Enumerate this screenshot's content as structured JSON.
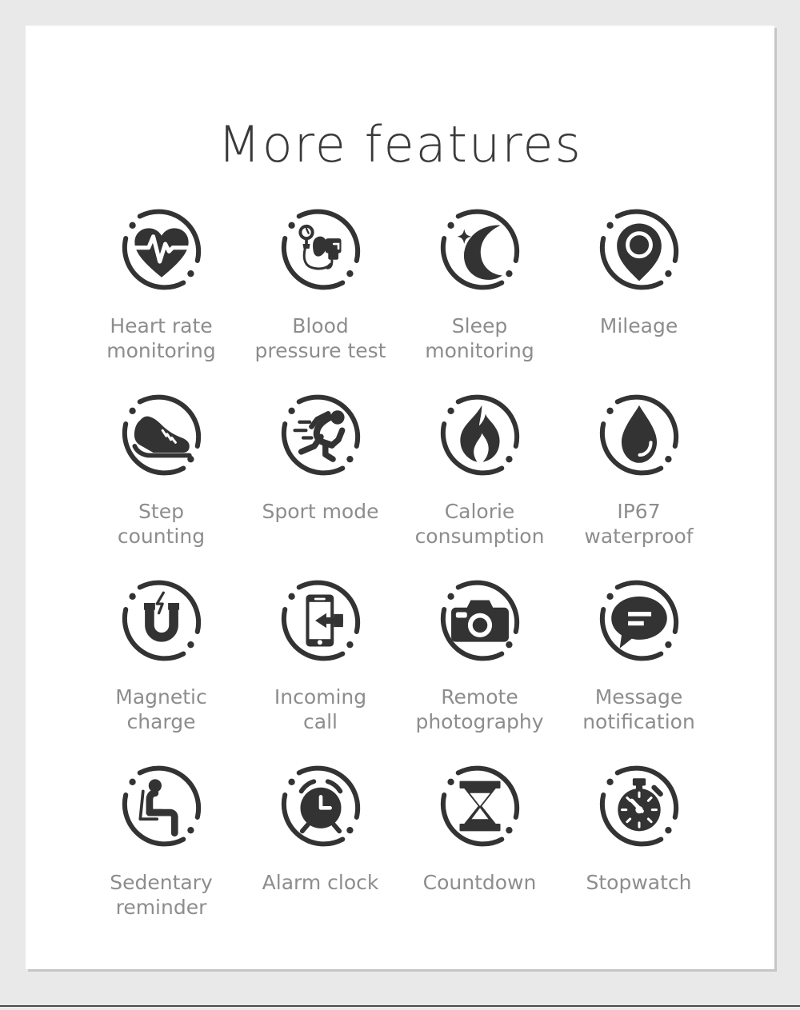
{
  "page": {
    "title": "More features",
    "background_color": "#e9e9e9",
    "card_color": "#ffffff",
    "title_color": "#3a3a3a",
    "label_color": "#8d8d8d",
    "icon_color": "#333333"
  },
  "features": [
    {
      "icon": "heart-rate-icon",
      "label": "Heart rate\nmonitoring"
    },
    {
      "icon": "blood-pressure-icon",
      "label": "Blood\npressure test"
    },
    {
      "icon": "moon-stars-icon",
      "label": "Sleep\nmonitoring"
    },
    {
      "icon": "map-pin-icon",
      "label": "Mileage"
    },
    {
      "icon": "sneaker-icon",
      "label": "Step\ncounting"
    },
    {
      "icon": "runner-icon",
      "label": "Sport mode"
    },
    {
      "icon": "flame-icon",
      "label": "Calorie\nconsumption"
    },
    {
      "icon": "water-drop-icon",
      "label": "IP67\nwaterproof"
    },
    {
      "icon": "magnet-icon",
      "label": "Magnetic\ncharge"
    },
    {
      "icon": "phone-incoming-icon",
      "label": "Incoming\ncall"
    },
    {
      "icon": "camera-icon",
      "label": "Remote\nphotography"
    },
    {
      "icon": "speech-bubble-icon",
      "label": "Message\nnotification"
    },
    {
      "icon": "sitting-person-icon",
      "label": "Sedentary\nreminder"
    },
    {
      "icon": "alarm-clock-icon",
      "label": "Alarm clock"
    },
    {
      "icon": "hourglass-icon",
      "label": "Countdown"
    },
    {
      "icon": "stopwatch-icon",
      "label": "Stopwatch"
    }
  ]
}
